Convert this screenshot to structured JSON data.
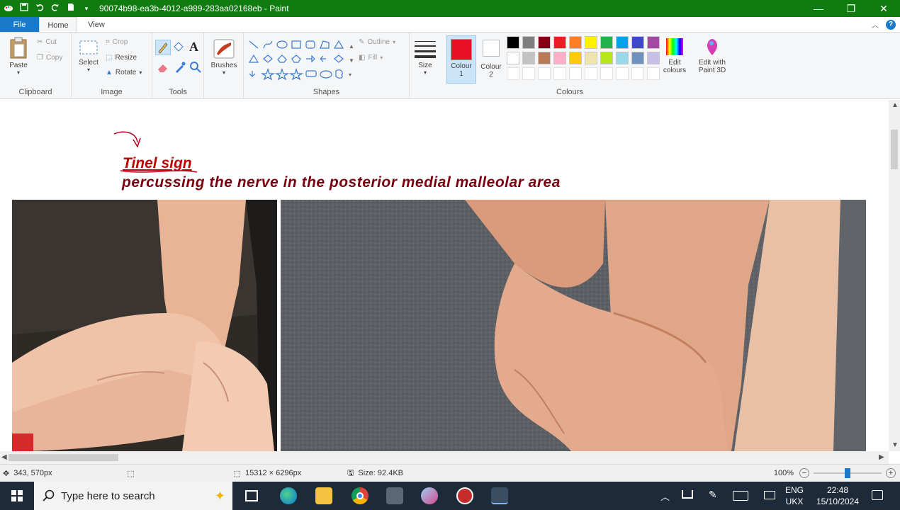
{
  "window": {
    "title": "90074b98-ea3b-4012-a989-283aa02168eb - Paint",
    "minimize_glyph": "—",
    "maximize_glyph": "❐",
    "close_glyph": "✕"
  },
  "tabs": {
    "file": "File",
    "home": "Home",
    "view": "View"
  },
  "ribbon": {
    "clipboard": {
      "label": "Clipboard",
      "paste": "Paste",
      "cut": "Cut",
      "copy": "Copy"
    },
    "image": {
      "label": "Image",
      "select": "Select",
      "crop": "Crop",
      "resize": "Resize",
      "rotate": "Rotate"
    },
    "tools": {
      "label": "Tools"
    },
    "brushes": {
      "label": "Brushes"
    },
    "shapes": {
      "label": "Shapes",
      "outline": "Outline",
      "fill": "Fill"
    },
    "size": {
      "label": "Size"
    },
    "colour1": {
      "label": "Colour",
      "num": "1",
      "color": "#e81123"
    },
    "colour2": {
      "label": "Colour",
      "num": "2",
      "color": "#ffffff"
    },
    "colours": {
      "label": "Colours",
      "edit_label": "Edit",
      "edit_label2": "colours",
      "paint3d_label": "Edit with",
      "paint3d_label2": "Paint 3D",
      "row1": [
        "#000000",
        "#7f7f7f",
        "#880015",
        "#ed1c24",
        "#ff7f27",
        "#fff200",
        "#22b14c",
        "#00a2e8",
        "#3f48cc",
        "#a349a4"
      ],
      "row2": [
        "#ffffff",
        "#c3c3c3",
        "#b97a57",
        "#ffaec9",
        "#ffc90e",
        "#efe4b0",
        "#b5e61d",
        "#99d9ea",
        "#7092be",
        "#c8bfe7"
      ]
    }
  },
  "canvas": {
    "heading": "Tinel sign",
    "subheading": "percussing the nerve in the posterior medial malleolar area"
  },
  "statusbar": {
    "cursor_pos": "343, 570px",
    "image_size": "15312 × 6296px",
    "file_size": "Size: 92.4KB",
    "zoom": "100%",
    "zoom_level": 0.5
  },
  "taskbar": {
    "search_placeholder": "Type here to search",
    "lang1": "ENG",
    "lang2": "UKX",
    "time": "22:48",
    "date": "15/10/2024"
  }
}
